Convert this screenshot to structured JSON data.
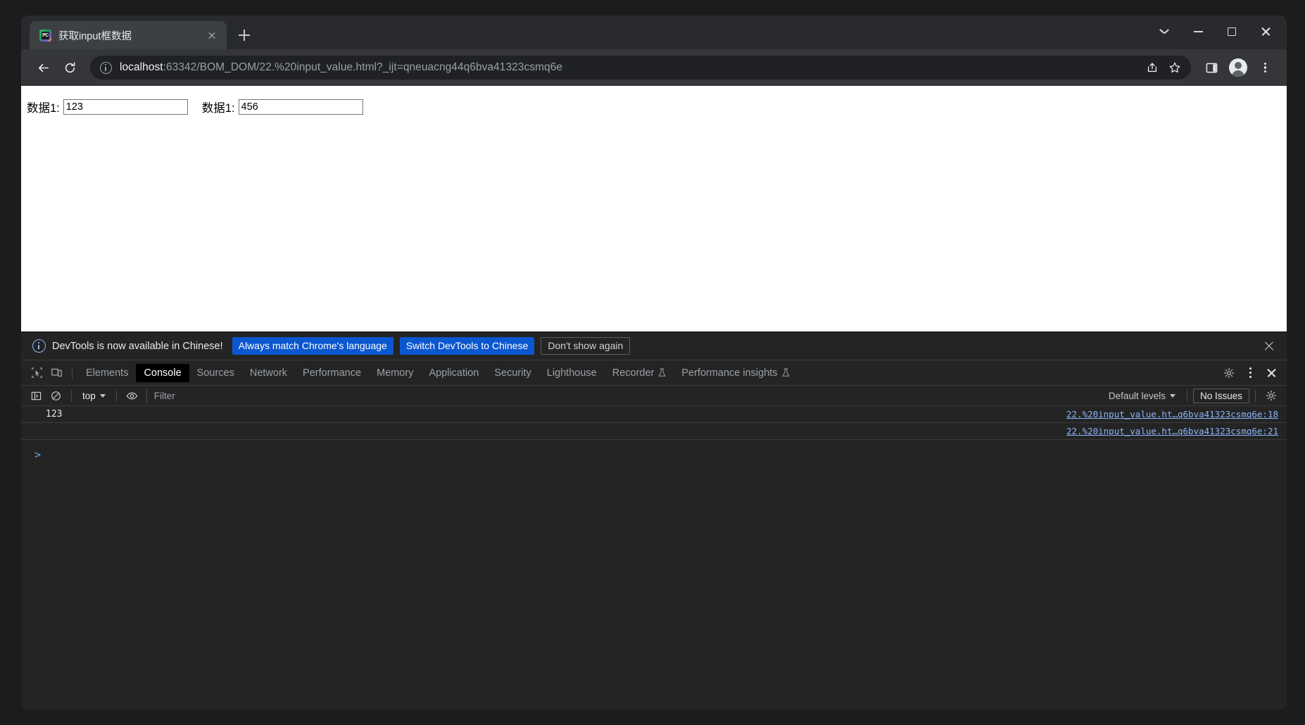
{
  "window": {
    "controls": {
      "collapse": "chevron-down",
      "minimize": "minimize",
      "maximize": "maximize",
      "close": "close"
    }
  },
  "tabstrip": {
    "tabs": [
      {
        "title": "获取input框数据",
        "favicon_label": "PC",
        "close_label": "×"
      }
    ],
    "new_tab_label": "+"
  },
  "toolbar": {
    "back_icon": "back-arrow-icon",
    "forward_icon": "forward-arrow-icon",
    "reload_icon": "reload-icon",
    "omnibox": {
      "security_icon": "info-circle-icon",
      "host": "localhost",
      "path": ":63342/BOM_DOM/22.%20input_value.html?_ijt=qneuacng44q6bva41323csmq6e",
      "full_url": "localhost:63342/BOM_DOM/22.%20input_value.html?_ijt=qneuacng44q6bva41323csmq6e",
      "share_icon": "share-icon",
      "bookmark_icon": "star-icon"
    },
    "side_panel_icon": "side-panel-icon",
    "profile_icon": "profile-avatar-icon",
    "menu_icon": "three-dot-menu-icon"
  },
  "page": {
    "fields": [
      {
        "label": "数据1:",
        "value": "123"
      },
      {
        "label": "数据1:",
        "value": "456"
      }
    ]
  },
  "devtools": {
    "banner": {
      "info_icon": "info-circle-icon",
      "message": "DevTools is now available in Chinese!",
      "primary_button": "Always match Chrome's language",
      "secondary_button": "Switch DevTools to Chinese",
      "dismiss_button": "Don't show again",
      "close_icon": "close-icon"
    },
    "tabs": {
      "inspect_icon": "inspect-element-icon",
      "device_icon": "device-toolbar-icon",
      "items": [
        {
          "label": "Elements",
          "active": false,
          "experimental": false
        },
        {
          "label": "Console",
          "active": true,
          "experimental": false
        },
        {
          "label": "Sources",
          "active": false,
          "experimental": false
        },
        {
          "label": "Network",
          "active": false,
          "experimental": false
        },
        {
          "label": "Performance",
          "active": false,
          "experimental": false
        },
        {
          "label": "Memory",
          "active": false,
          "experimental": false
        },
        {
          "label": "Application",
          "active": false,
          "experimental": false
        },
        {
          "label": "Security",
          "active": false,
          "experimental": false
        },
        {
          "label": "Lighthouse",
          "active": false,
          "experimental": false
        },
        {
          "label": "Recorder",
          "active": false,
          "experimental": true
        },
        {
          "label": "Performance insights",
          "active": false,
          "experimental": true
        }
      ],
      "settings_icon": "gear-icon",
      "more_icon": "three-dot-menu-icon",
      "close_icon": "close-icon"
    },
    "filterbar": {
      "sidebar_icon": "console-sidebar-icon",
      "clear_icon": "clear-console-icon",
      "context": "top",
      "eye_icon": "live-expression-icon",
      "filter_placeholder": "Filter",
      "filter_value": "",
      "levels": "Default levels",
      "issues": "No Issues",
      "settings_icon": "gear-icon"
    },
    "console": {
      "rows": [
        {
          "message": "123",
          "source": "22.%20input_value.ht…q6bva41323csmq6e:18"
        },
        {
          "message": "",
          "source": "22.%20input_value.ht…q6bva41323csmq6e:21"
        }
      ],
      "prompt": ">"
    }
  },
  "colors": {
    "accent_blue": "#0b57d0",
    "link_blue": "#8ab4f8",
    "devtools_bg": "#242424",
    "toolbar_bg": "#35363a",
    "tabstrip_bg": "#292a2d"
  }
}
